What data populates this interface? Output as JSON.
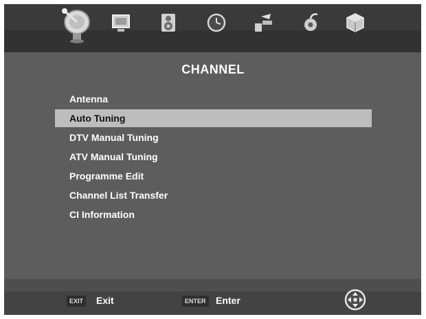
{
  "menu_bar": {
    "tabs": [
      {
        "name": "channel",
        "icon": "satellite-dish-icon",
        "active": true
      },
      {
        "name": "picture",
        "icon": "monitor-icon",
        "active": false
      },
      {
        "name": "sound",
        "icon": "speaker-icon",
        "active": false
      },
      {
        "name": "time",
        "icon": "clock-icon",
        "active": false
      },
      {
        "name": "setup",
        "icon": "tools-icon",
        "active": false
      },
      {
        "name": "lock",
        "icon": "lock-icon",
        "active": false
      },
      {
        "name": "app",
        "icon": "cube-icon",
        "active": false
      }
    ]
  },
  "page": {
    "title": "CHANNEL"
  },
  "menu": {
    "selected_index": 1,
    "items": [
      {
        "label": "Antenna"
      },
      {
        "label": "Auto Tuning"
      },
      {
        "label": "DTV Manual Tuning"
      },
      {
        "label": "ATV Manual Tuning"
      },
      {
        "label": "Programme Edit"
      },
      {
        "label": "Channel List Transfer"
      },
      {
        "label": "CI Information"
      }
    ]
  },
  "footer": {
    "exit_key": "EXIT",
    "exit_label": "Exit",
    "enter_key": "ENTER",
    "enter_label": "Enter",
    "nav_icon": "dpad-icon"
  },
  "colors": {
    "background": "#5d5d5d",
    "top_bar": "#3a3a3a",
    "highlight": "#bdbdbd",
    "text": "#ffffff"
  }
}
